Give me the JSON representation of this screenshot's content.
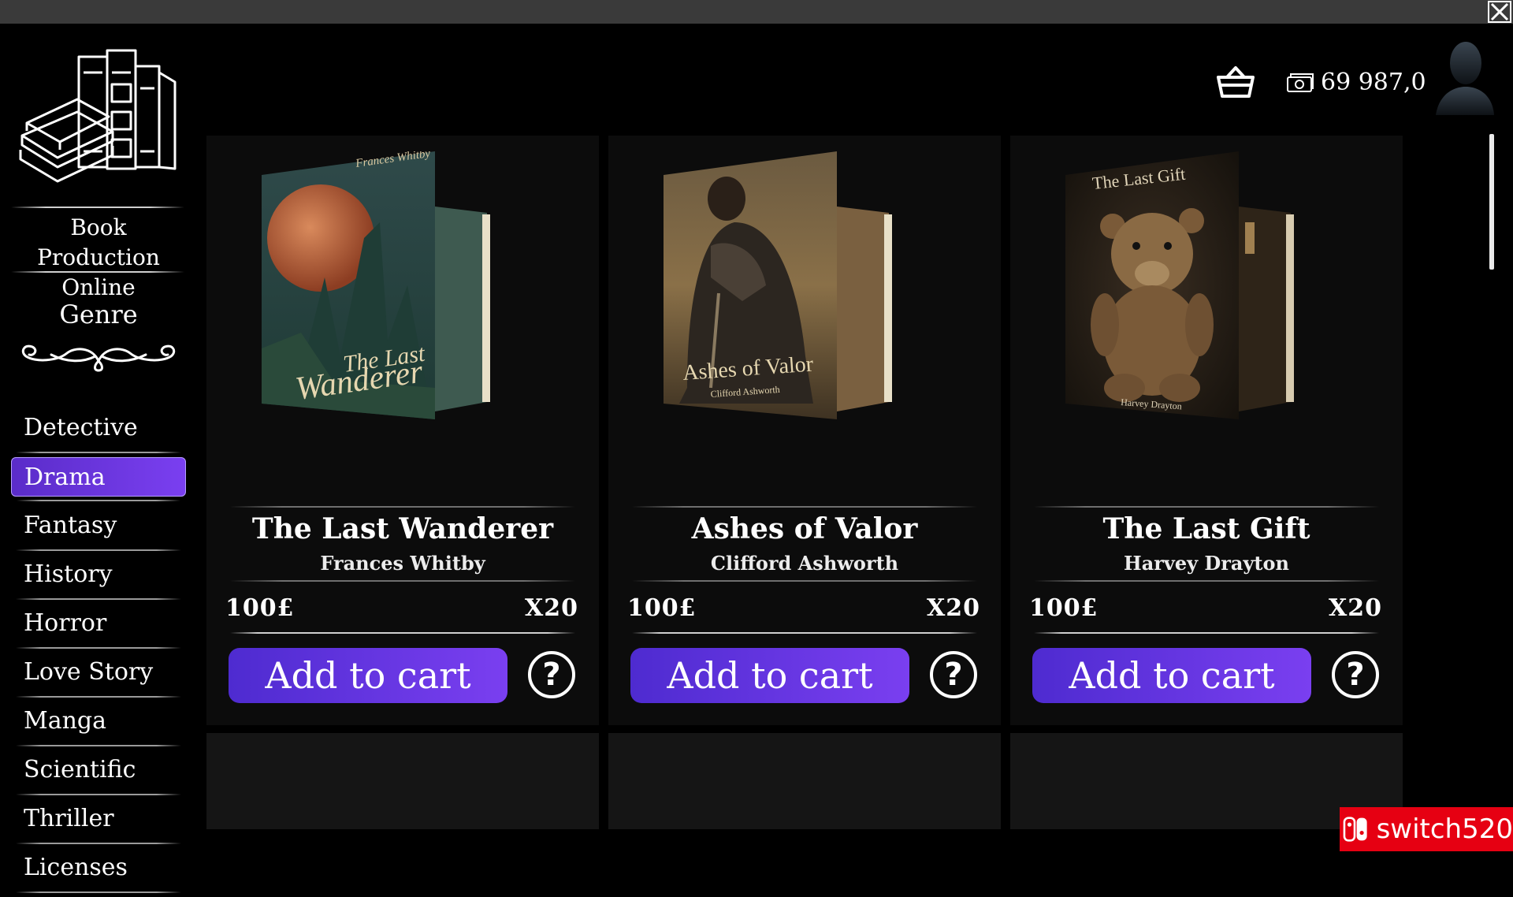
{
  "app": {
    "title_line1": "Book Production",
    "title_line2": "Online",
    "close_icon": "close-icon"
  },
  "header": {
    "basket_icon": "basket-icon",
    "money_icon": "banknote-icon",
    "money": "69 987,0",
    "avatar_icon": "user-silhouette-icon"
  },
  "sidebar": {
    "genre_heading": "Genre",
    "genres": [
      {
        "label": "Detective",
        "active": false
      },
      {
        "label": "Drama",
        "active": true
      },
      {
        "label": "Fantasy",
        "active": false
      },
      {
        "label": "History",
        "active": false
      },
      {
        "label": "Horror",
        "active": false
      },
      {
        "label": "Love Story",
        "active": false
      },
      {
        "label": "Manga",
        "active": false
      },
      {
        "label": "Scientific",
        "active": false
      },
      {
        "label": "Thriller",
        "active": false
      },
      {
        "label": "Licenses",
        "active": false
      }
    ]
  },
  "books": [
    {
      "title": "The Last Wanderer",
      "author": "Frances Whitby",
      "price": "100£",
      "quantity": "X20",
      "cover_title_line1": "The Last",
      "cover_title_line2": "Wanderer",
      "cover_author": "Frances Whitby",
      "add_to_cart": "Add to cart",
      "help": "?"
    },
    {
      "title": "Ashes of Valor",
      "author": "Clifford Ashworth",
      "price": "100£",
      "quantity": "X20",
      "cover_title_line1": "Ashes of Valor",
      "cover_author": "Clifford Ashworth",
      "add_to_cart": "Add to cart",
      "help": "?"
    },
    {
      "title": "The Last Gift",
      "author": "Harvey Drayton",
      "price": "100£",
      "quantity": "X20",
      "cover_title_line1": "The Last Gift",
      "cover_author": "Harvey Drayton",
      "add_to_cart": "Add to cart",
      "help": "?"
    }
  ],
  "watermark": {
    "text": "switch520"
  },
  "colors": {
    "accent": "#6a35e6",
    "background": "#000000",
    "card": "#0c0c0c",
    "badge": "#e60012"
  }
}
